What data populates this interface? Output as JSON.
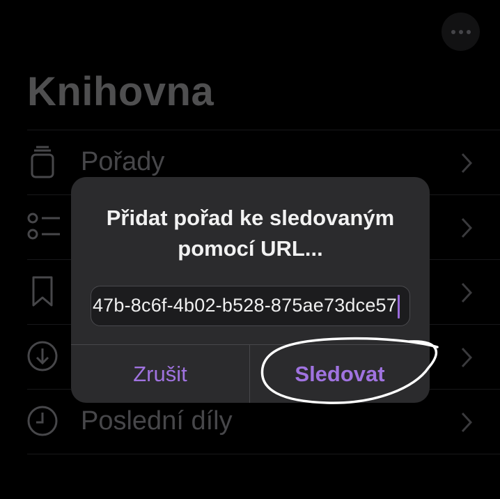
{
  "header": {
    "title": "Knihovna",
    "more_icon": "ellipsis-icon"
  },
  "library_rows": [
    {
      "label": "Pořady",
      "icon": "podcast-stack-icon"
    },
    {
      "label": "",
      "icon": "list-icon"
    },
    {
      "label": "",
      "icon": "bookmark-icon"
    },
    {
      "label": "",
      "icon": "download-icon"
    },
    {
      "label": "Poslední díly",
      "icon": "clock-icon"
    }
  ],
  "dialog": {
    "title": "Přidat pořad ke sledovaným pomocí URL...",
    "url_value": "47b-8c6f-4b02-b528-875ae73dce57",
    "cancel_label": "Zrušit",
    "confirm_label": "Sledovat"
  },
  "colors": {
    "accent": "#a073e0",
    "background": "#000000",
    "dialog_bg": "#2b2b2d",
    "annotation": "#ffffff"
  }
}
